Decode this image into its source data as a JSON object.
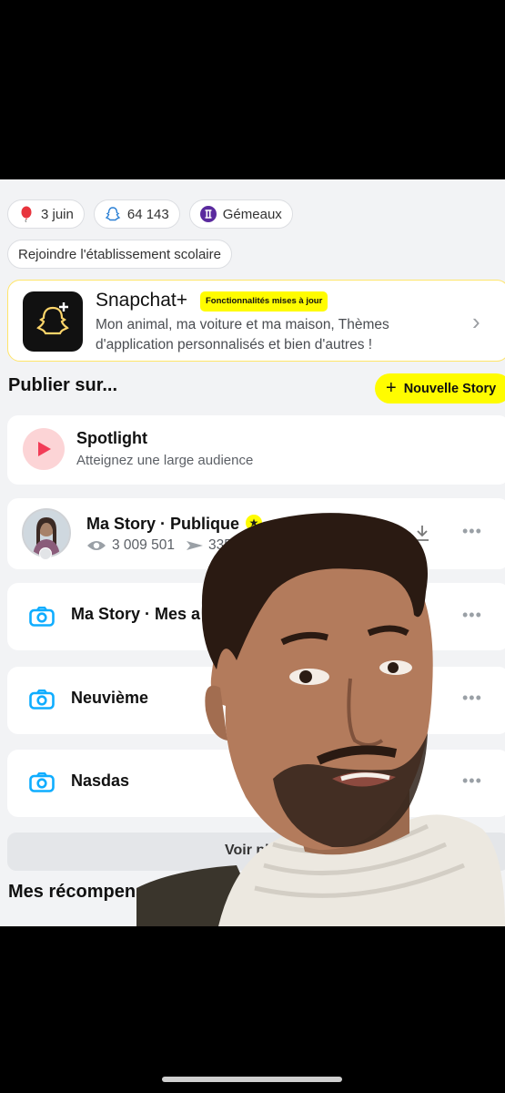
{
  "profile_chips": [
    {
      "icon": "balloon-icon",
      "label": "3 juin"
    },
    {
      "icon": "snap-score-icon",
      "label": "64 143"
    },
    {
      "icon": "gemini-icon",
      "label": "Gémeaux"
    }
  ],
  "school_chip": {
    "label": "Rejoindre l'établissement scolaire"
  },
  "snapchat_plus": {
    "title": "Snapchat+",
    "badge": "Fonctionnalités mises à jour",
    "description": "Mon animal, ma voiture et ma maison, Thèmes d'application personnalisés et bien d'autres !"
  },
  "publish": {
    "title": "Publier sur...",
    "new_story_label": "Nouvelle Story",
    "spotlight": {
      "title": "Spotlight",
      "subtitle": "Atteignez une large audience"
    },
    "public_story": {
      "title": "Ma Story · Publique",
      "views": "3 009 501",
      "shares": "335"
    },
    "stories": [
      {
        "label": "Ma Story · Mes a"
      },
      {
        "label": "Neuvième"
      },
      {
        "label": "Nasdas"
      }
    ],
    "see_more_label": "Voir pl"
  },
  "rewards_title": "Mes récompenses pou",
  "colors": {
    "snap_yellow": "#fffc00",
    "camera_blue": "#0fadff",
    "spotlight_red": "#f23c57"
  }
}
